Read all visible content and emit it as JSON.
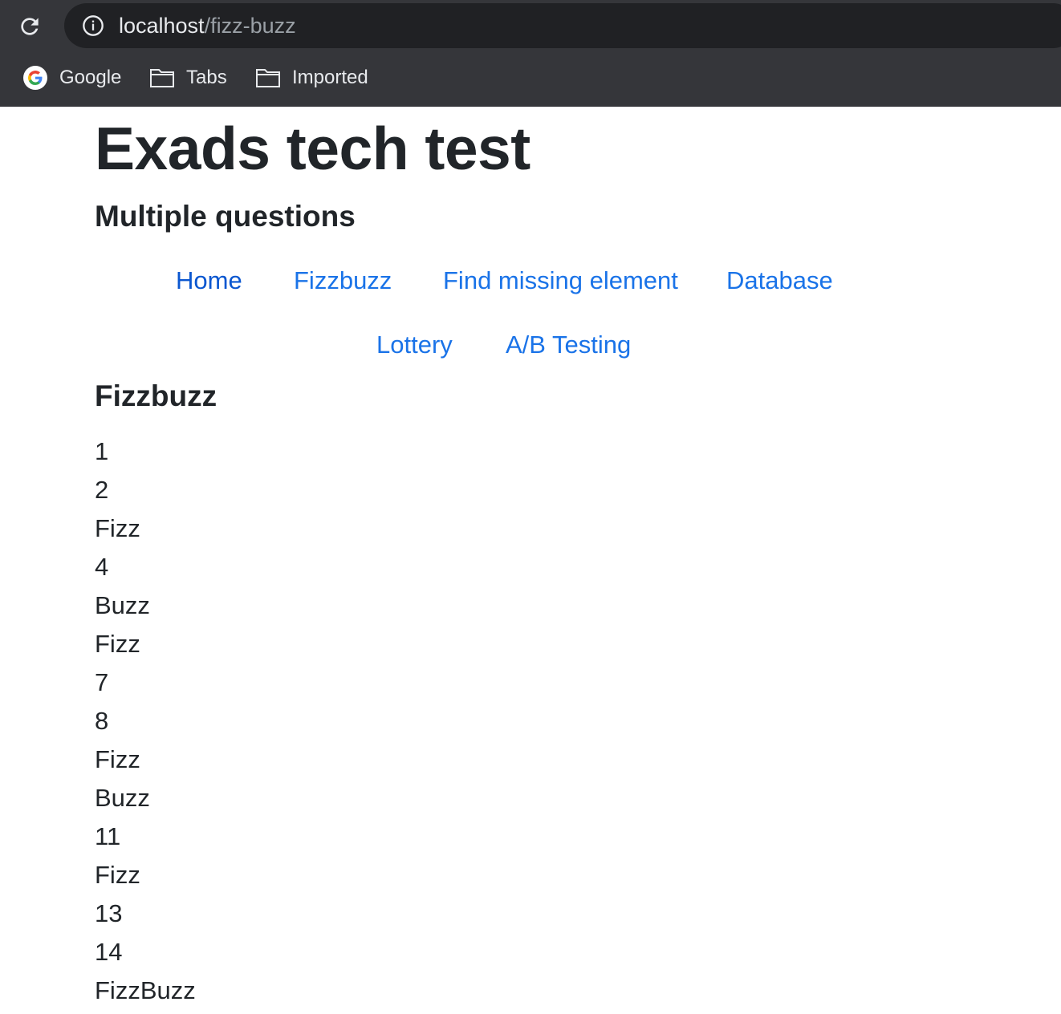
{
  "browser": {
    "url_host": "localhost",
    "url_path": "/fizz-buzz",
    "bookmarks": [
      {
        "label": "Google",
        "icon": "google-icon"
      },
      {
        "label": "Tabs",
        "icon": "folder-icon"
      },
      {
        "label": "Imported",
        "icon": "folder-icon"
      }
    ]
  },
  "page": {
    "title": "Exads tech test",
    "subtitle": "Multiple questions",
    "nav": [
      {
        "label": "Home"
      },
      {
        "label": "Fizzbuzz"
      },
      {
        "label": "Find missing element"
      },
      {
        "label": "Database"
      },
      {
        "label": "Lottery"
      },
      {
        "label": "A/B Testing"
      }
    ],
    "section_title": "Fizzbuzz",
    "results": [
      "1",
      "2",
      "Fizz",
      "4",
      "Buzz",
      "Fizz",
      "7",
      "8",
      "Fizz",
      "Buzz",
      "11",
      "Fizz",
      "13",
      "14",
      "FizzBuzz"
    ]
  },
  "colors": {
    "link": "#1a73e8",
    "text": "#212529",
    "chrome_bg": "#35363a",
    "omnibox_bg": "#202124"
  }
}
